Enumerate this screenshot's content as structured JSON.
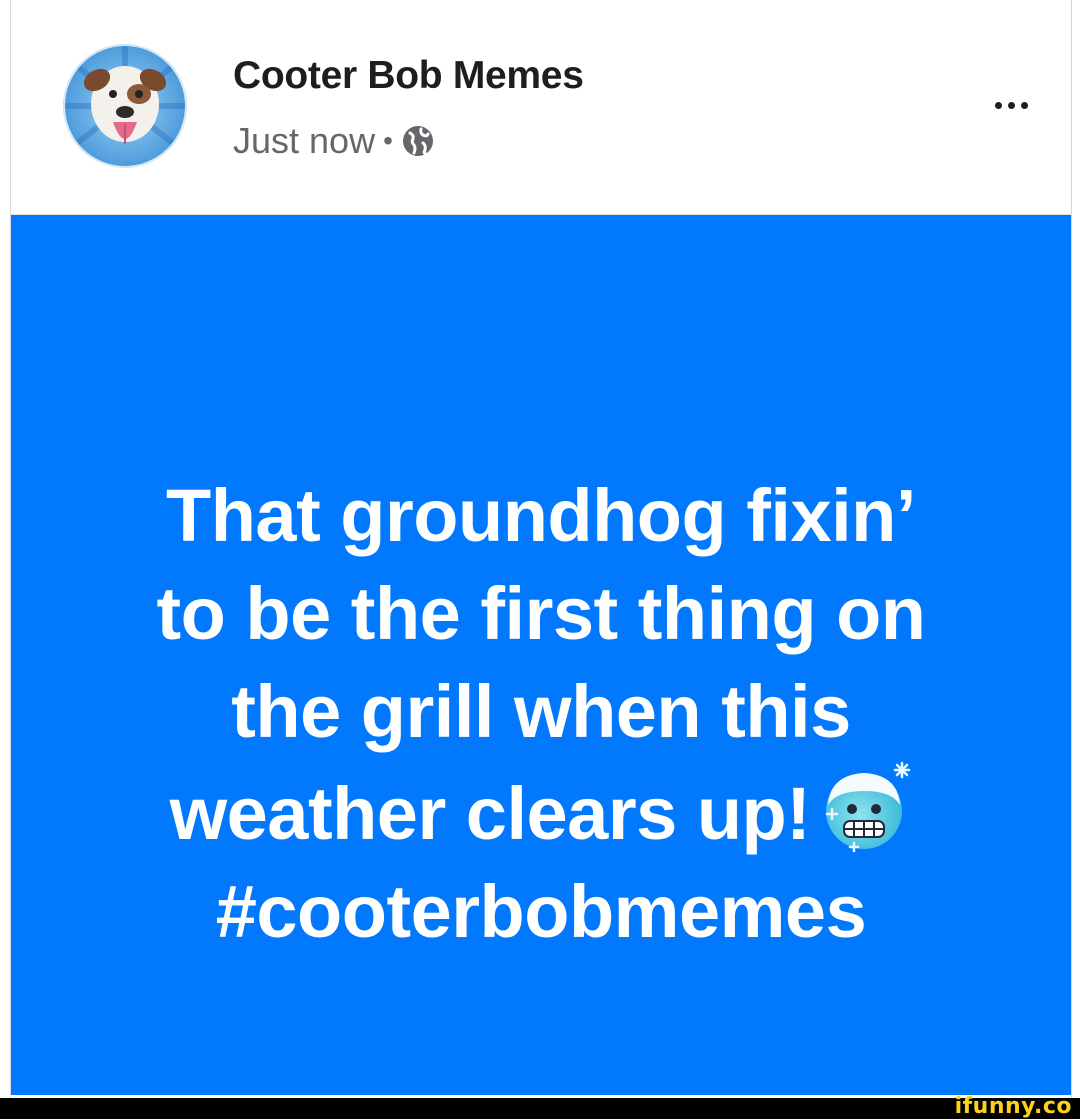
{
  "post": {
    "page_name": "Cooter Bob Memes",
    "timestamp": "Just now",
    "separator": "•",
    "privacy_icon": "globe-icon",
    "more_icon": "more-options-icon",
    "body_lines": [
      "That groundhog fixin’",
      "to be the first thing on",
      "the grill when this",
      "weather clears up!",
      "#cooterbobmemes"
    ],
    "emoji": "cold-face-emoji",
    "background_color": "#0278fc",
    "text_color": "#ffffff"
  },
  "watermark": {
    "text": "ifunny.co",
    "color": "#ffd21a"
  }
}
